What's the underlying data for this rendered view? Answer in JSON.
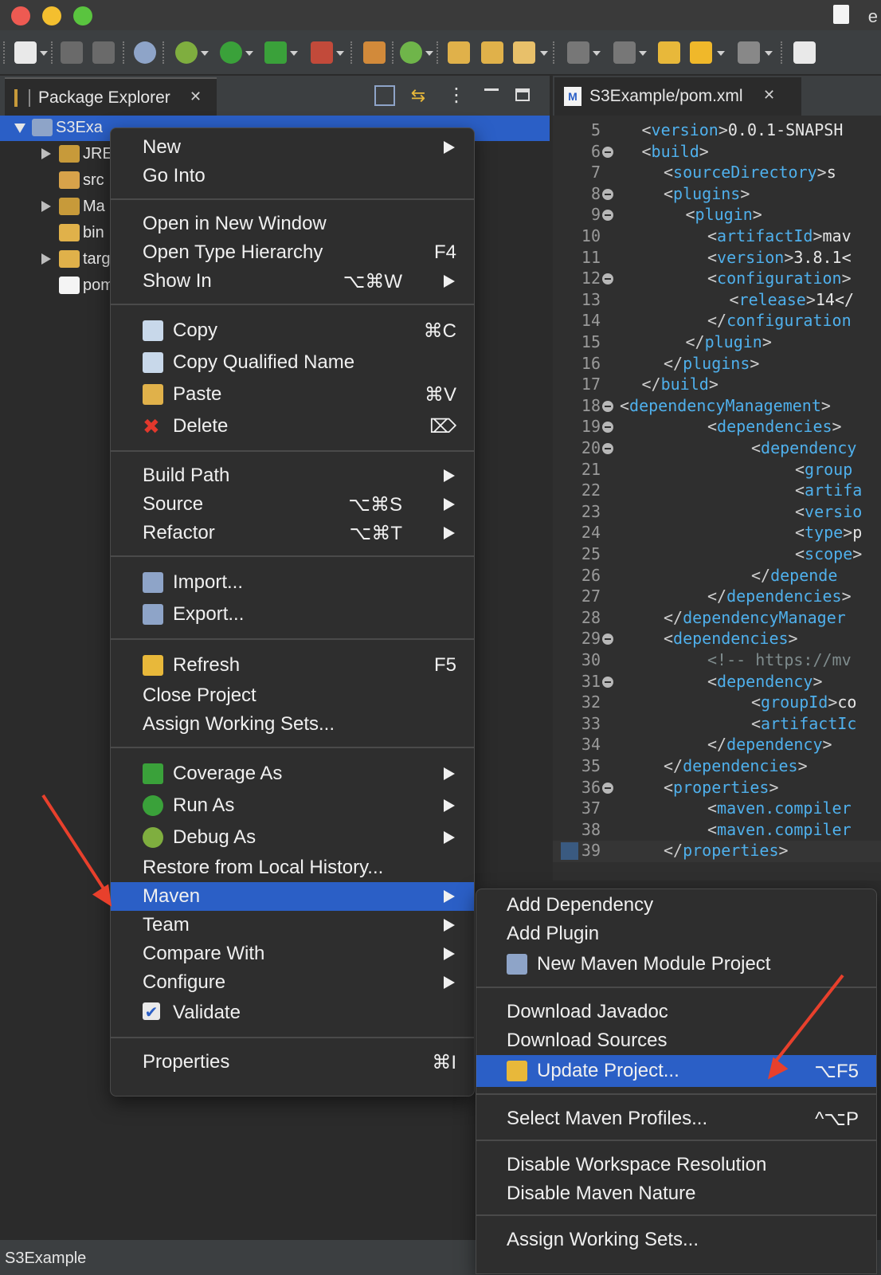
{
  "window": {
    "title_fragment": "e"
  },
  "package_explorer": {
    "tab_label": "Package Explorer",
    "tree": [
      {
        "label": "S3Exa",
        "expanded": true,
        "selected": true,
        "has_twisty": true,
        "icon": "maven-project-icon"
      },
      {
        "label": "JRE",
        "has_twisty": true,
        "icon": "library-icon"
      },
      {
        "label": "src",
        "has_twisty": false,
        "icon": "source-folder-icon"
      },
      {
        "label": "Ma",
        "has_twisty": true,
        "icon": "library-icon"
      },
      {
        "label": "bin",
        "has_twisty": false,
        "icon": "folder-icon"
      },
      {
        "label": "targ",
        "has_twisty": true,
        "icon": "folder-icon"
      },
      {
        "label": "pom",
        "has_twisty": false,
        "icon": "maven-file-icon"
      }
    ]
  },
  "editor": {
    "tab_label": "S3Example/pom.xml",
    "lines": [
      {
        "n": "5",
        "fold": false,
        "indent": 1,
        "tokens": [
          [
            "b",
            "<"
          ],
          [
            "t",
            "version"
          ],
          [
            "b",
            ">"
          ],
          [
            "x",
            "0.0.1-SNAPSH"
          ]
        ]
      },
      {
        "n": "6",
        "fold": true,
        "indent": 1,
        "tokens": [
          [
            "b",
            "<"
          ],
          [
            "t",
            "build"
          ],
          [
            "b",
            ">"
          ]
        ]
      },
      {
        "n": "7",
        "fold": false,
        "indent": 2,
        "tokens": [
          [
            "b",
            "<"
          ],
          [
            "t",
            "sourceDirectory"
          ],
          [
            "b",
            ">"
          ],
          [
            "x",
            "s"
          ]
        ]
      },
      {
        "n": "8",
        "fold": true,
        "indent": 2,
        "tokens": [
          [
            "b",
            "<"
          ],
          [
            "t",
            "plugins"
          ],
          [
            "b",
            ">"
          ]
        ]
      },
      {
        "n": "9",
        "fold": true,
        "indent": 3,
        "tokens": [
          [
            "b",
            "<"
          ],
          [
            "t",
            "plugin"
          ],
          [
            "b",
            ">"
          ]
        ]
      },
      {
        "n": "10",
        "fold": false,
        "indent": 4,
        "tokens": [
          [
            "b",
            "<"
          ],
          [
            "t",
            "artifactId"
          ],
          [
            "b",
            ">"
          ],
          [
            "x",
            "mav"
          ]
        ]
      },
      {
        "n": "11",
        "fold": false,
        "indent": 4,
        "tokens": [
          [
            "b",
            "<"
          ],
          [
            "t",
            "version"
          ],
          [
            "b",
            ">"
          ],
          [
            "x",
            "3.8.1<"
          ]
        ]
      },
      {
        "n": "12",
        "fold": true,
        "indent": 4,
        "tokens": [
          [
            "b",
            "<"
          ],
          [
            "t",
            "configuration"
          ],
          [
            "b",
            ">"
          ]
        ]
      },
      {
        "n": "13",
        "fold": false,
        "indent": 5,
        "tokens": [
          [
            "b",
            "<"
          ],
          [
            "t",
            "release"
          ],
          [
            "b",
            ">"
          ],
          [
            "x",
            "14</"
          ]
        ]
      },
      {
        "n": "14",
        "fold": false,
        "indent": 4,
        "tokens": [
          [
            "b",
            "</"
          ],
          [
            "t",
            "configuration"
          ]
        ]
      },
      {
        "n": "15",
        "fold": false,
        "indent": 3,
        "tokens": [
          [
            "b",
            "</"
          ],
          [
            "t",
            "plugin"
          ],
          [
            "b",
            ">"
          ]
        ]
      },
      {
        "n": "16",
        "fold": false,
        "indent": 2,
        "tokens": [
          [
            "b",
            "</"
          ],
          [
            "t",
            "plugins"
          ],
          [
            "b",
            ">"
          ]
        ]
      },
      {
        "n": "17",
        "fold": false,
        "indent": 1,
        "tokens": [
          [
            "b",
            "</"
          ],
          [
            "t",
            "build"
          ],
          [
            "b",
            ">"
          ]
        ]
      },
      {
        "n": "18",
        "fold": true,
        "indent": 0,
        "tokens": [
          [
            "b",
            "<"
          ],
          [
            "t",
            "dependencyManagement"
          ],
          [
            "b",
            ">"
          ]
        ]
      },
      {
        "n": "19",
        "fold": true,
        "indent": 4,
        "tokens": [
          [
            "b",
            "<"
          ],
          [
            "t",
            "dependencies"
          ],
          [
            "b",
            ">"
          ]
        ]
      },
      {
        "n": "20",
        "fold": true,
        "indent": 6,
        "tokens": [
          [
            "b",
            "<"
          ],
          [
            "t",
            "dependency"
          ]
        ]
      },
      {
        "n": "21",
        "fold": false,
        "indent": 8,
        "tokens": [
          [
            "b",
            "<"
          ],
          [
            "t",
            "group"
          ]
        ]
      },
      {
        "n": "22",
        "fold": false,
        "indent": 8,
        "tokens": [
          [
            "b",
            "<"
          ],
          [
            "t",
            "artifa"
          ]
        ]
      },
      {
        "n": "23",
        "fold": false,
        "indent": 8,
        "tokens": [
          [
            "b",
            "<"
          ],
          [
            "t",
            "versio"
          ]
        ]
      },
      {
        "n": "24",
        "fold": false,
        "indent": 8,
        "tokens": [
          [
            "b",
            "<"
          ],
          [
            "t",
            "type"
          ],
          [
            "b",
            ">"
          ],
          [
            "x",
            "p"
          ]
        ]
      },
      {
        "n": "25",
        "fold": false,
        "indent": 8,
        "tokens": [
          [
            "b",
            "<"
          ],
          [
            "t",
            "scope"
          ],
          [
            "b",
            ">"
          ]
        ]
      },
      {
        "n": "26",
        "fold": false,
        "indent": 6,
        "tokens": [
          [
            "b",
            "</"
          ],
          [
            "t",
            "depende"
          ]
        ]
      },
      {
        "n": "27",
        "fold": false,
        "indent": 4,
        "tokens": [
          [
            "b",
            "</"
          ],
          [
            "t",
            "dependencies"
          ],
          [
            "b",
            ">"
          ]
        ]
      },
      {
        "n": "28",
        "fold": false,
        "indent": 2,
        "tokens": [
          [
            "b",
            "</"
          ],
          [
            "t",
            "dependencyManager"
          ]
        ]
      },
      {
        "n": "29",
        "fold": true,
        "indent": 2,
        "tokens": [
          [
            "b",
            "<"
          ],
          [
            "t",
            "dependencies"
          ],
          [
            "b",
            ">"
          ]
        ]
      },
      {
        "n": "30",
        "fold": false,
        "indent": 4,
        "tokens": [
          [
            "c",
            "<!-- https://mv"
          ]
        ]
      },
      {
        "n": "31",
        "fold": true,
        "indent": 4,
        "tokens": [
          [
            "b",
            "<"
          ],
          [
            "t",
            "dependency"
          ],
          [
            "b",
            ">"
          ]
        ]
      },
      {
        "n": "32",
        "fold": false,
        "indent": 6,
        "tokens": [
          [
            "b",
            "<"
          ],
          [
            "t",
            "groupId"
          ],
          [
            "b",
            ">"
          ],
          [
            "x",
            "co"
          ]
        ]
      },
      {
        "n": "33",
        "fold": false,
        "indent": 6,
        "tokens": [
          [
            "b",
            "<"
          ],
          [
            "t",
            "artifactIc"
          ]
        ]
      },
      {
        "n": "34",
        "fold": false,
        "indent": 4,
        "tokens": [
          [
            "b",
            "</"
          ],
          [
            "t",
            "dependency"
          ],
          [
            "b",
            ">"
          ]
        ]
      },
      {
        "n": "35",
        "fold": false,
        "indent": 2,
        "tokens": [
          [
            "b",
            "</"
          ],
          [
            "t",
            "dependencies"
          ],
          [
            "b",
            ">"
          ]
        ]
      },
      {
        "n": "36",
        "fold": true,
        "indent": 2,
        "tokens": [
          [
            "b",
            "<"
          ],
          [
            "t",
            "properties"
          ],
          [
            "b",
            ">"
          ]
        ]
      },
      {
        "n": "37",
        "fold": false,
        "indent": 4,
        "tokens": [
          [
            "b",
            "<"
          ],
          [
            "t",
            "maven.compiler"
          ]
        ]
      },
      {
        "n": "38",
        "fold": false,
        "indent": 4,
        "tokens": [
          [
            "b",
            "<"
          ],
          [
            "t",
            "maven.compiler"
          ]
        ]
      },
      {
        "n": "39",
        "fold": false,
        "indent": 2,
        "tokens": [
          [
            "b",
            "</"
          ],
          [
            "t",
            "properties"
          ],
          [
            "b",
            ">"
          ]
        ]
      }
    ]
  },
  "context_menu": {
    "groups": [
      [
        {
          "label": "New",
          "submenu": true
        },
        {
          "label": "Go Into"
        }
      ],
      [
        {
          "label": "Open in New Window"
        },
        {
          "label": "Open Type Hierarchy",
          "shortcut": "F4"
        },
        {
          "label": "Show In",
          "shortcut": "⌥⌘W",
          "submenu": true
        }
      ],
      [
        {
          "label": "Copy",
          "shortcut": "⌘C",
          "icon": "copy-icon"
        },
        {
          "label": "Copy Qualified Name",
          "icon": "copy-qualified-icon"
        },
        {
          "label": "Paste",
          "shortcut": "⌘V",
          "icon": "paste-icon"
        },
        {
          "label": "Delete",
          "shortcut": "⌦",
          "icon": "delete-icon"
        }
      ],
      [
        {
          "label": "Build Path",
          "submenu": true
        },
        {
          "label": "Source",
          "shortcut": "⌥⌘S",
          "submenu": true
        },
        {
          "label": "Refactor",
          "shortcut": "⌥⌘T",
          "submenu": true
        }
      ],
      [
        {
          "label": "Import...",
          "icon": "import-icon"
        },
        {
          "label": "Export...",
          "icon": "export-icon"
        }
      ],
      [
        {
          "label": "Refresh",
          "shortcut": "F5",
          "icon": "refresh-icon"
        },
        {
          "label": "Close Project"
        },
        {
          "label": "Assign Working Sets..."
        }
      ],
      [
        {
          "label": "Coverage As",
          "submenu": true,
          "icon": "coverage-icon"
        },
        {
          "label": "Run As",
          "submenu": true,
          "icon": "run-icon"
        },
        {
          "label": "Debug As",
          "submenu": true,
          "icon": "debug-icon"
        },
        {
          "label": "Restore from Local History..."
        },
        {
          "label": "Maven",
          "submenu": true,
          "highlighted": true
        },
        {
          "label": "Team",
          "submenu": true
        },
        {
          "label": "Compare With",
          "submenu": true
        },
        {
          "label": "Configure",
          "submenu": true
        },
        {
          "label": "Validate",
          "icon": "checkbox-icon"
        }
      ],
      [
        {
          "label": "Properties",
          "shortcut": "⌘I"
        }
      ]
    ]
  },
  "maven_submenu": {
    "groups": [
      [
        {
          "label": "Add Dependency"
        },
        {
          "label": "Add Plugin"
        },
        {
          "label": "New Maven Module Project",
          "icon": "maven-module-icon"
        }
      ],
      [
        {
          "label": "Download Javadoc"
        },
        {
          "label": "Download Sources"
        },
        {
          "label": "Update Project...",
          "shortcut": "⌥F5",
          "highlighted": true,
          "icon": "maven-update-icon"
        }
      ],
      [
        {
          "label": "Select Maven Profiles...",
          "shortcut": "^⌥P"
        }
      ],
      [
        {
          "label": "Disable Workspace Resolution"
        },
        {
          "label": "Disable Maven Nature"
        }
      ],
      [
        {
          "label": "Assign Working Sets..."
        }
      ]
    ]
  },
  "status_bar": {
    "text": "S3Example"
  },
  "colors": {
    "highlight": "#2b5fc6",
    "annotation_arrow": "#e8402c",
    "xml_tag": "#4fb0ec"
  }
}
